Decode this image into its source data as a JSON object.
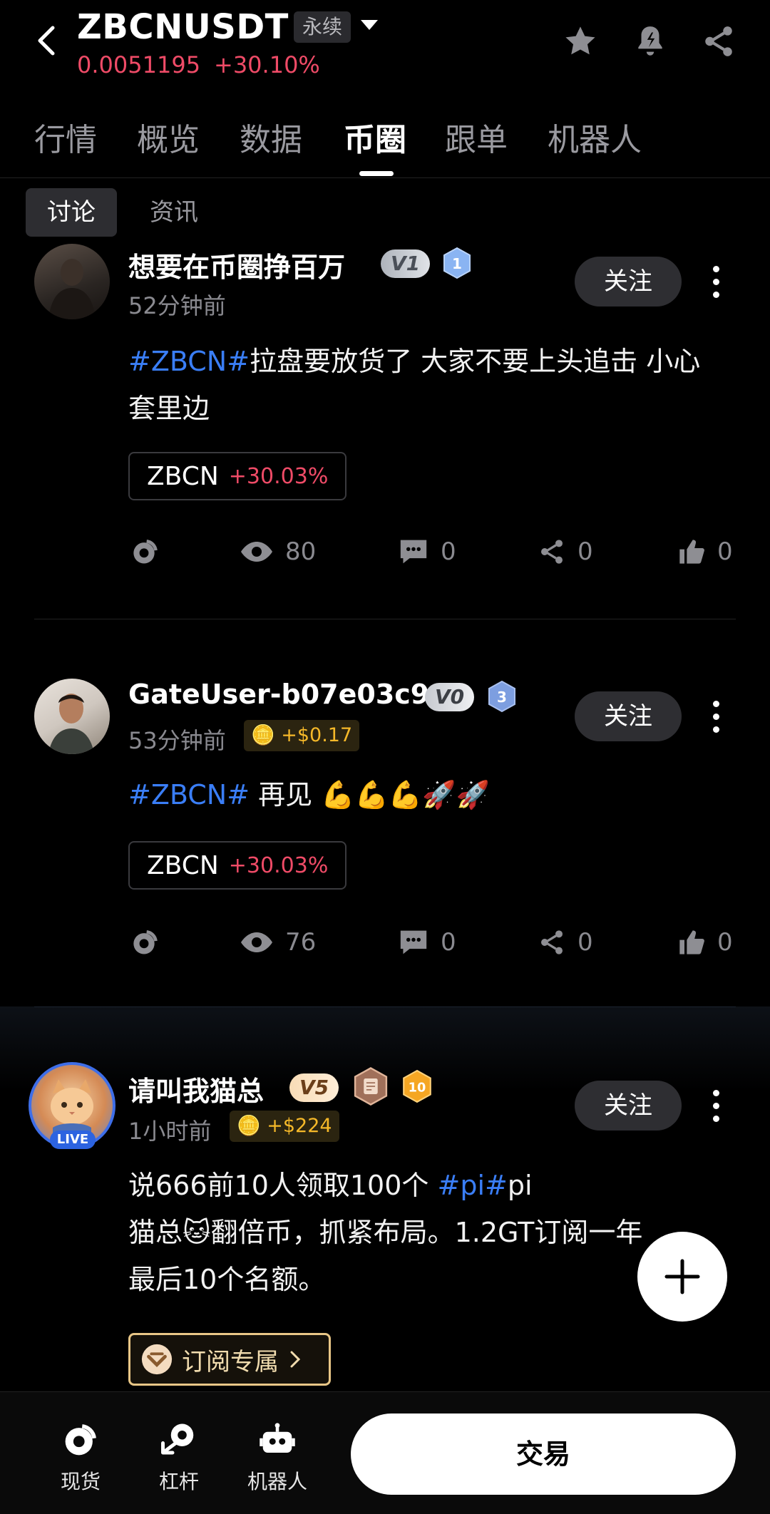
{
  "header": {
    "symbol": "ZBCNUSDT",
    "perp_tag": "永续",
    "price": "0.0051195",
    "change": "+30.10%"
  },
  "tabs": [
    "行情",
    "概览",
    "数据",
    "币圈",
    "跟单",
    "机器人"
  ],
  "active_tab": "币圈",
  "subtabs": [
    "讨论",
    "资讯"
  ],
  "follow_label": "关注",
  "posts": [
    {
      "username": "想要在币圈挣百万",
      "vip": "V1",
      "level": "1",
      "time": "52分钟前",
      "hashtag": "#ZBCN#",
      "text": "拉盘要放货了 大家不要上头追击 小心套里边",
      "coin": "ZBCN",
      "coin_change": "+30.03%",
      "views": "80",
      "comments": "0",
      "shares": "0",
      "likes": "0"
    },
    {
      "username": "GateUser-b07e03c9",
      "vip": "V0",
      "level": "3",
      "time": "53分钟前",
      "reward": "+$0.17",
      "hashtag": "#ZBCN#",
      "text": " 再见 💪💪💪🚀🚀",
      "coin": "ZBCN",
      "coin_change": "+30.03%",
      "views": "76",
      "comments": "0",
      "shares": "0",
      "likes": "0"
    },
    {
      "username": "请叫我猫总",
      "vip": "V5",
      "level": "10",
      "live": "LIVE",
      "time": "1小时前",
      "reward": "+$224",
      "line1_pre": "说666前10人领取100个 ",
      "line1_tag": "#pi#",
      "line1_post": "pi",
      "line2": "猫总🐱翻倍币，抓紧布局。1.2GT订阅一年",
      "line3": "最后10个名额。",
      "subscribe": "订阅专属"
    }
  ],
  "bottom_nav": [
    "现货",
    "杠杆",
    "机器人"
  ],
  "trade_label": "交易"
}
